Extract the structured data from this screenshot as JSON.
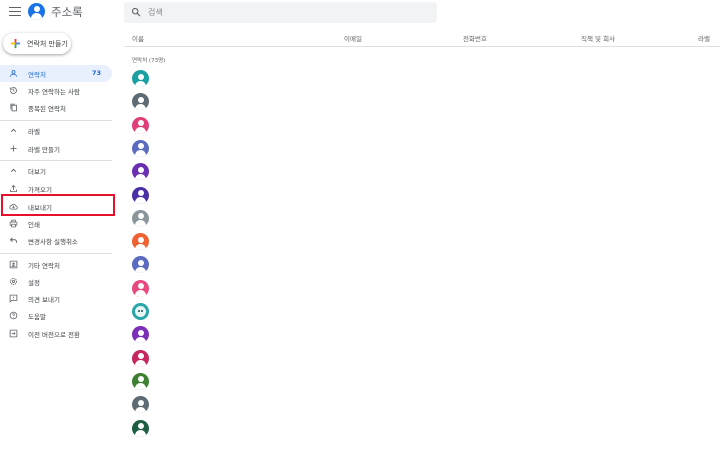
{
  "header": {
    "app_title": "주소록",
    "search_placeholder": "검색"
  },
  "sidebar": {
    "create_label": "연락처 만들기",
    "items": [
      {
        "label": "연락처",
        "count": "73",
        "icon": "person-icon",
        "active": true
      },
      {
        "label": "자주 연락하는 사람",
        "icon": "history-icon"
      },
      {
        "label": "중복된 연락처",
        "icon": "copy-icon"
      }
    ],
    "labels_section": {
      "label": "라벨",
      "icon": "chevron-up-icon"
    },
    "create_label_item": {
      "label": "라벨 만들기",
      "icon": "plus-icon"
    },
    "more_section": {
      "label": "더보기",
      "icon": "chevron-up-icon"
    },
    "more_items": [
      {
        "label": "가져오기",
        "icon": "upload-icon"
      },
      {
        "label": "내보내기",
        "icon": "cloud-download-icon"
      },
      {
        "label": "인쇄",
        "icon": "print-icon"
      },
      {
        "label": "변경사항 실행취소",
        "icon": "undo-icon"
      }
    ],
    "bottom_items": [
      {
        "label": "기타 연락처",
        "icon": "contact-box-icon"
      },
      {
        "label": "설정",
        "icon": "gear-icon"
      },
      {
        "label": "의견 보내기",
        "icon": "feedback-icon"
      },
      {
        "label": "도움말",
        "icon": "help-icon"
      },
      {
        "label": "이전 버전으로 전환",
        "icon": "exit-icon"
      }
    ]
  },
  "table": {
    "columns": [
      "이름",
      "이메일",
      "전화번호",
      "직책 및 회사",
      "라벨"
    ],
    "section_label": "연락처 (73명)",
    "avatars": [
      "#1aa0a0",
      "#5f6b73",
      "#e0407a",
      "#5b6bc0",
      "#6a2fb0",
      "#4a2fa6",
      "#8a959c",
      "#f06232",
      "#5b6bc0",
      "#e84a80",
      "photo",
      "#7b2fb8",
      "#c6275e",
      "#3e8032",
      "#5f6b73",
      "#1e5e42"
    ]
  },
  "colors": {
    "accent": "#1a73e8",
    "active_bg": "#e8f0fe",
    "highlight_box": "#e8112d"
  }
}
